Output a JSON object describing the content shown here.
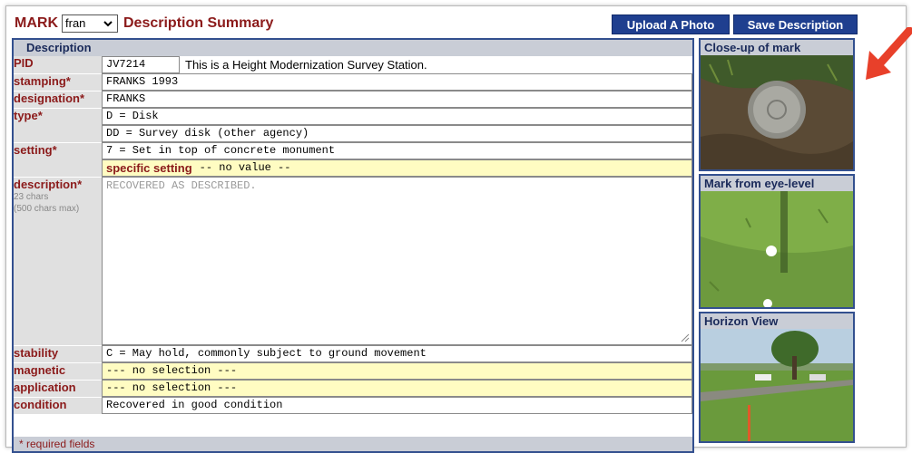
{
  "header": {
    "mark_label": "MARK",
    "mark_select": "fran",
    "title": "Description Summary",
    "upload_label": "Upload A Photo",
    "save_label": "Save Description"
  },
  "form": {
    "section_title": "Description",
    "pid": {
      "label": "PID",
      "value": "JV7214",
      "note": "This is a Height Modernization Survey Station."
    },
    "stamping": {
      "label": "stamping*",
      "value": "FRANKS 1993"
    },
    "designation": {
      "label": "designation*",
      "value": "FRANKS"
    },
    "type": {
      "label": "type*",
      "value1": "D = Disk",
      "value2": "DD = Survey disk (other agency)"
    },
    "setting": {
      "label": "setting*",
      "value": "7 = Set in top of concrete monument",
      "specific_label": "specific setting",
      "specific_value": "-- no value --"
    },
    "description": {
      "label": "description*",
      "chars": "23 chars",
      "max": "(500 chars max)",
      "value": "RECOVERED AS DESCRIBED."
    },
    "stability": {
      "label": "stability",
      "value": "C = May hold, commonly subject to ground movement"
    },
    "magnetic": {
      "label": "magnetic",
      "value": "--- no selection ---"
    },
    "application": {
      "label": "application",
      "value": "--- no selection ---"
    },
    "condition": {
      "label": "condition",
      "value": "Recovered in good condition"
    },
    "required_note": "* required fields"
  },
  "photos": [
    {
      "title": "Close-up of mark"
    },
    {
      "title": "Mark from eye-level"
    },
    {
      "title": "Horizon View"
    }
  ],
  "colors": {
    "accent": "#8b1a1a",
    "button": "#1f3f8f",
    "panel_border": "#33508f",
    "highlight": "#fffcc2",
    "arrow": "#e8402a"
  },
  "icons": {
    "select": "chevron-down-icon",
    "annotation": "arrow-icon",
    "resize": "resize-handle-icon"
  }
}
